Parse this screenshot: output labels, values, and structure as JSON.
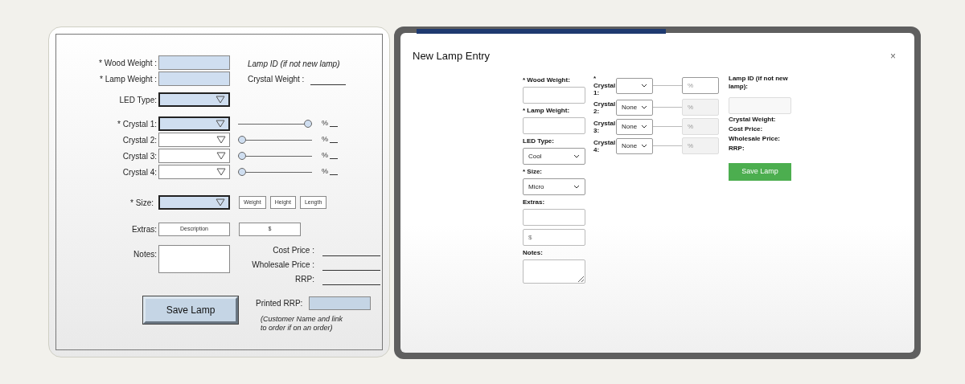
{
  "mockup": {
    "weights": [
      {
        "label": "* Wood Weight :"
      },
      {
        "label": "* Lamp Weight :"
      }
    ],
    "lamp_id_note": "Lamp ID (if not new lamp)",
    "crystal_weight_label": "Crystal Weight :",
    "led_type_label": "LED Type:",
    "crystals": [
      {
        "label": "* Crystal 1:",
        "highlighted": true,
        "level": 1,
        "percent": "%"
      },
      {
        "label": "Crystal 2:",
        "highlighted": false,
        "level": 0,
        "percent": "%"
      },
      {
        "label": "Crystal 3:",
        "highlighted": false,
        "level": 0,
        "percent": "%"
      },
      {
        "label": "Crystal 4:",
        "highlighted": false,
        "level": 0,
        "percent": "%"
      }
    ],
    "size_label": "* Size:",
    "size_buttons": [
      "Weight",
      "Height",
      "Length"
    ],
    "extras_label": "Extras:",
    "extras_fields": [
      "Description",
      "$"
    ],
    "notes_label": "Notes:",
    "prices": [
      "Cost Price :",
      "Wholesale Price :",
      "RRP:"
    ],
    "save_button": "Save Lamp",
    "printed_rrp_label": "Printed RRP:",
    "customer_note": "(Customer Name and link to order if on an order)"
  },
  "modal": {
    "title": "New Lamp Entry",
    "close": "×",
    "fields": [
      {
        "kind": "label",
        "text": "* Wood Weight:"
      },
      {
        "kind": "input"
      },
      {
        "kind": "label",
        "text": "* Lamp Weight:"
      },
      {
        "kind": "input"
      },
      {
        "kind": "label",
        "text": "LED Type:"
      },
      {
        "kind": "select",
        "value": "Cool"
      },
      {
        "kind": "label",
        "text": "* Size:"
      },
      {
        "kind": "select",
        "value": "Micro"
      },
      {
        "kind": "label",
        "text": "Extras:"
      },
      {
        "kind": "input"
      },
      {
        "kind": "input",
        "placeholder": "$"
      },
      {
        "kind": "label",
        "text": "Notes:"
      },
      {
        "kind": "textarea"
      }
    ],
    "crystals": [
      {
        "label": "* Crystal 1:",
        "placeholder": "%",
        "disabled": false
      },
      {
        "label": "Crystal 2:",
        "value": "None",
        "placeholder": "%",
        "disabled": true
      },
      {
        "label": "Crystal 3:",
        "value": "None",
        "placeholder": "%",
        "disabled": true
      },
      {
        "label": "Crystal 4:",
        "value": "None",
        "placeholder": "%",
        "disabled": true
      }
    ],
    "lamp_id_label": "Lamp ID (if not new lamp):",
    "info": [
      "Crystal Weight:",
      "Cost Price:",
      "Wholesale Price:",
      "RRP:"
    ],
    "save_button": "Save Lamp"
  }
}
